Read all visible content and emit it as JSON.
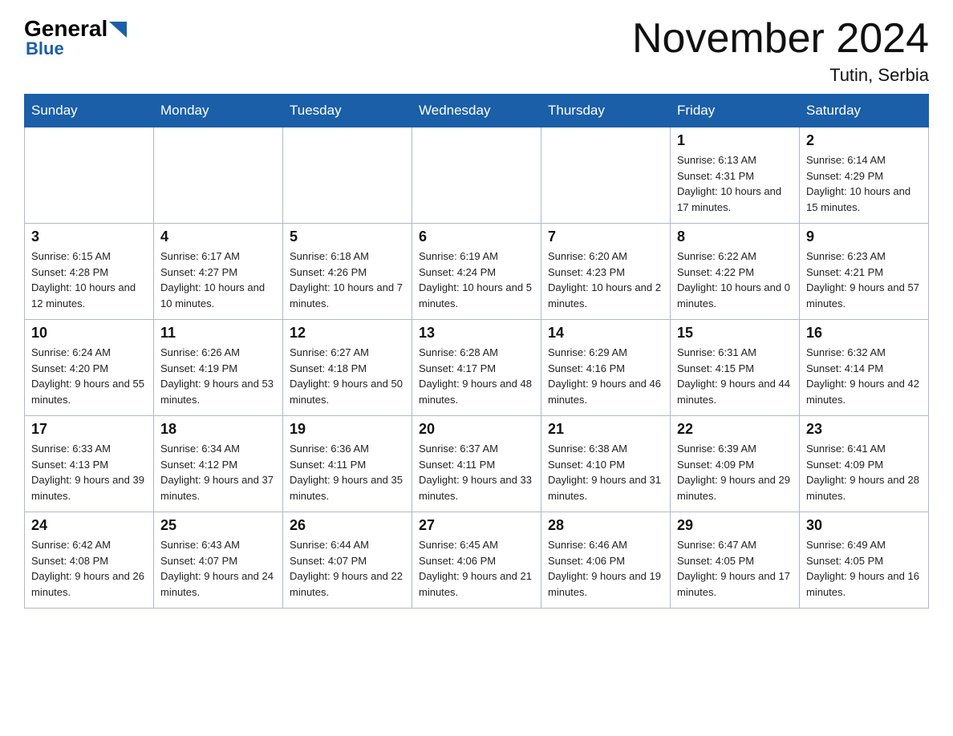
{
  "header": {
    "title": "November 2024",
    "location": "Tutin, Serbia"
  },
  "logo": {
    "general": "General",
    "blue": "Blue"
  },
  "weekdays": [
    "Sunday",
    "Monday",
    "Tuesday",
    "Wednesday",
    "Thursday",
    "Friday",
    "Saturday"
  ],
  "weeks": [
    [
      {
        "day": "",
        "info": ""
      },
      {
        "day": "",
        "info": ""
      },
      {
        "day": "",
        "info": ""
      },
      {
        "day": "",
        "info": ""
      },
      {
        "day": "",
        "info": ""
      },
      {
        "day": "1",
        "info": "Sunrise: 6:13 AM\nSunset: 4:31 PM\nDaylight: 10 hours\nand 17 minutes."
      },
      {
        "day": "2",
        "info": "Sunrise: 6:14 AM\nSunset: 4:29 PM\nDaylight: 10 hours\nand 15 minutes."
      }
    ],
    [
      {
        "day": "3",
        "info": "Sunrise: 6:15 AM\nSunset: 4:28 PM\nDaylight: 10 hours\nand 12 minutes."
      },
      {
        "day": "4",
        "info": "Sunrise: 6:17 AM\nSunset: 4:27 PM\nDaylight: 10 hours\nand 10 minutes."
      },
      {
        "day": "5",
        "info": "Sunrise: 6:18 AM\nSunset: 4:26 PM\nDaylight: 10 hours\nand 7 minutes."
      },
      {
        "day": "6",
        "info": "Sunrise: 6:19 AM\nSunset: 4:24 PM\nDaylight: 10 hours\nand 5 minutes."
      },
      {
        "day": "7",
        "info": "Sunrise: 6:20 AM\nSunset: 4:23 PM\nDaylight: 10 hours\nand 2 minutes."
      },
      {
        "day": "8",
        "info": "Sunrise: 6:22 AM\nSunset: 4:22 PM\nDaylight: 10 hours\nand 0 minutes."
      },
      {
        "day": "9",
        "info": "Sunrise: 6:23 AM\nSunset: 4:21 PM\nDaylight: 9 hours\nand 57 minutes."
      }
    ],
    [
      {
        "day": "10",
        "info": "Sunrise: 6:24 AM\nSunset: 4:20 PM\nDaylight: 9 hours\nand 55 minutes."
      },
      {
        "day": "11",
        "info": "Sunrise: 6:26 AM\nSunset: 4:19 PM\nDaylight: 9 hours\nand 53 minutes."
      },
      {
        "day": "12",
        "info": "Sunrise: 6:27 AM\nSunset: 4:18 PM\nDaylight: 9 hours\nand 50 minutes."
      },
      {
        "day": "13",
        "info": "Sunrise: 6:28 AM\nSunset: 4:17 PM\nDaylight: 9 hours\nand 48 minutes."
      },
      {
        "day": "14",
        "info": "Sunrise: 6:29 AM\nSunset: 4:16 PM\nDaylight: 9 hours\nand 46 minutes."
      },
      {
        "day": "15",
        "info": "Sunrise: 6:31 AM\nSunset: 4:15 PM\nDaylight: 9 hours\nand 44 minutes."
      },
      {
        "day": "16",
        "info": "Sunrise: 6:32 AM\nSunset: 4:14 PM\nDaylight: 9 hours\nand 42 minutes."
      }
    ],
    [
      {
        "day": "17",
        "info": "Sunrise: 6:33 AM\nSunset: 4:13 PM\nDaylight: 9 hours\nand 39 minutes."
      },
      {
        "day": "18",
        "info": "Sunrise: 6:34 AM\nSunset: 4:12 PM\nDaylight: 9 hours\nand 37 minutes."
      },
      {
        "day": "19",
        "info": "Sunrise: 6:36 AM\nSunset: 4:11 PM\nDaylight: 9 hours\nand 35 minutes."
      },
      {
        "day": "20",
        "info": "Sunrise: 6:37 AM\nSunset: 4:11 PM\nDaylight: 9 hours\nand 33 minutes."
      },
      {
        "day": "21",
        "info": "Sunrise: 6:38 AM\nSunset: 4:10 PM\nDaylight: 9 hours\nand 31 minutes."
      },
      {
        "day": "22",
        "info": "Sunrise: 6:39 AM\nSunset: 4:09 PM\nDaylight: 9 hours\nand 29 minutes."
      },
      {
        "day": "23",
        "info": "Sunrise: 6:41 AM\nSunset: 4:09 PM\nDaylight: 9 hours\nand 28 minutes."
      }
    ],
    [
      {
        "day": "24",
        "info": "Sunrise: 6:42 AM\nSunset: 4:08 PM\nDaylight: 9 hours\nand 26 minutes."
      },
      {
        "day": "25",
        "info": "Sunrise: 6:43 AM\nSunset: 4:07 PM\nDaylight: 9 hours\nand 24 minutes."
      },
      {
        "day": "26",
        "info": "Sunrise: 6:44 AM\nSunset: 4:07 PM\nDaylight: 9 hours\nand 22 minutes."
      },
      {
        "day": "27",
        "info": "Sunrise: 6:45 AM\nSunset: 4:06 PM\nDaylight: 9 hours\nand 21 minutes."
      },
      {
        "day": "28",
        "info": "Sunrise: 6:46 AM\nSunset: 4:06 PM\nDaylight: 9 hours\nand 19 minutes."
      },
      {
        "day": "29",
        "info": "Sunrise: 6:47 AM\nSunset: 4:05 PM\nDaylight: 9 hours\nand 17 minutes."
      },
      {
        "day": "30",
        "info": "Sunrise: 6:49 AM\nSunset: 4:05 PM\nDaylight: 9 hours\nand 16 minutes."
      }
    ]
  ]
}
